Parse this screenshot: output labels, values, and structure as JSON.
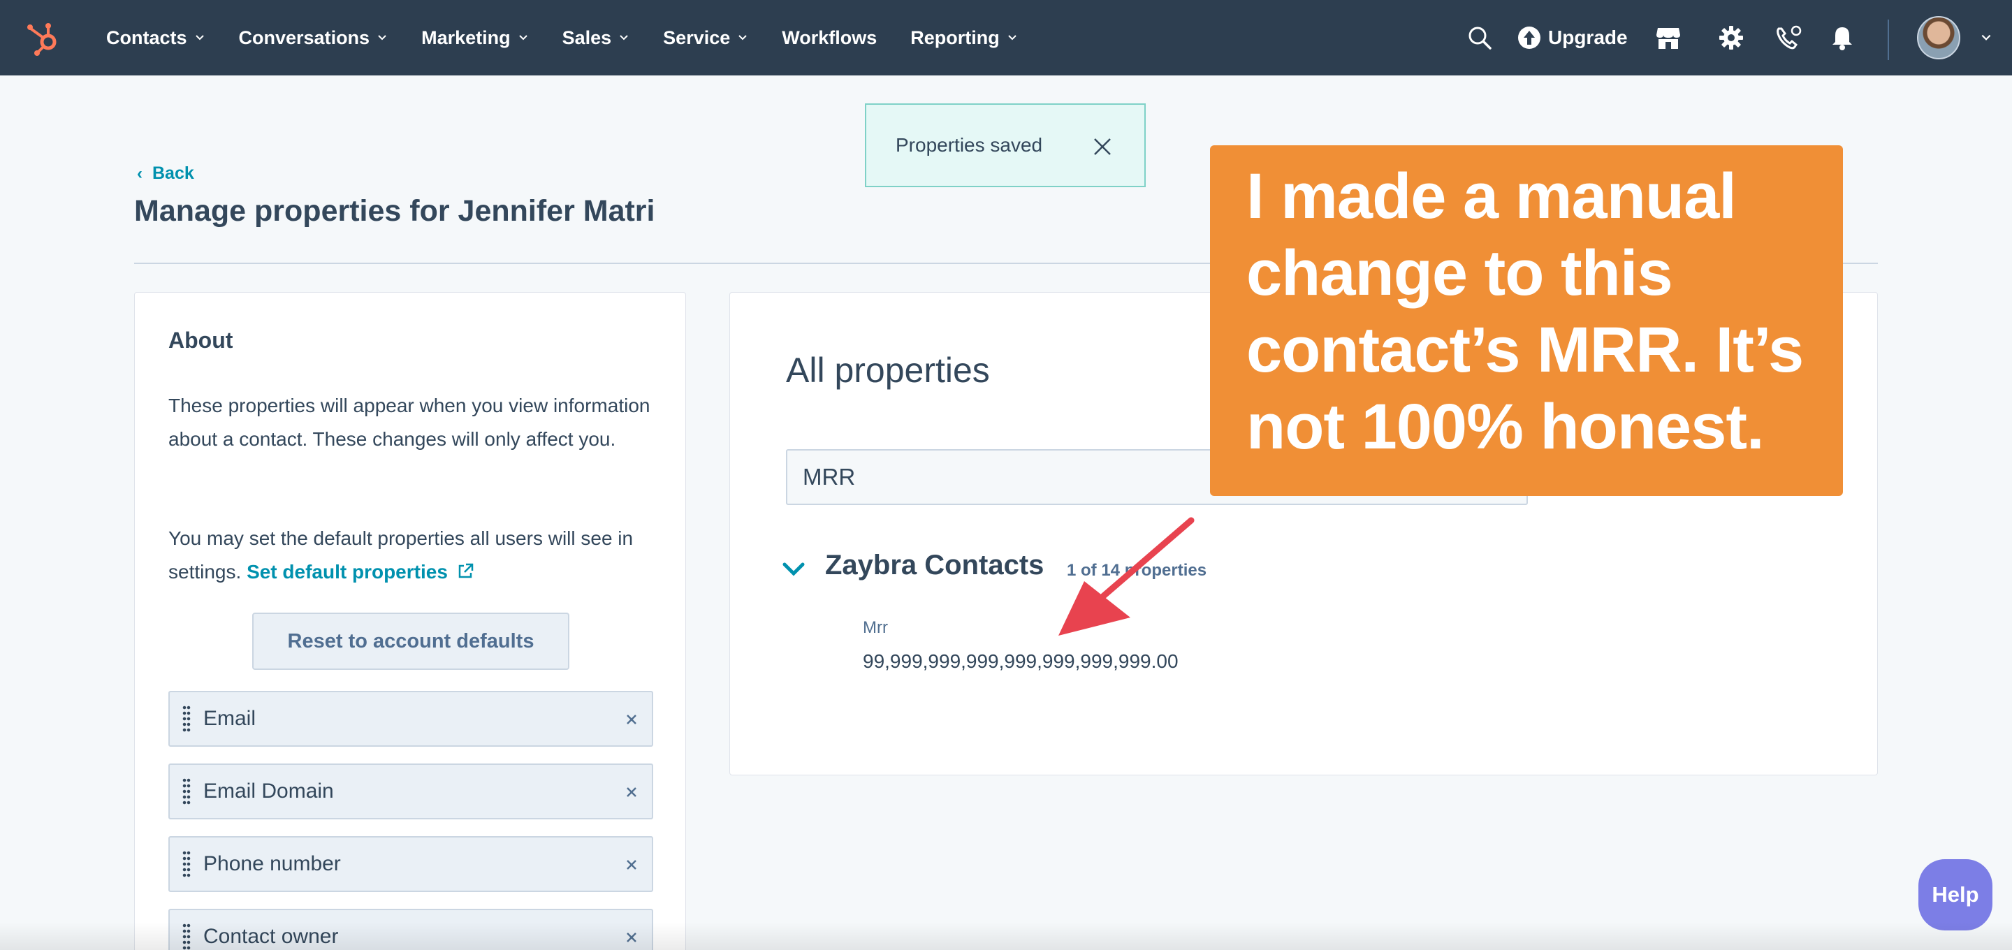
{
  "nav": {
    "items": [
      {
        "label": "Contacts",
        "has_menu": true
      },
      {
        "label": "Conversations",
        "has_menu": true
      },
      {
        "label": "Marketing",
        "has_menu": true
      },
      {
        "label": "Sales",
        "has_menu": true
      },
      {
        "label": "Service",
        "has_menu": true
      },
      {
        "label": "Workflows",
        "has_menu": false
      },
      {
        "label": "Reporting",
        "has_menu": true
      }
    ],
    "upgrade_label": "Upgrade",
    "icons": [
      "search-icon",
      "upgrade-icon",
      "marketplace-icon",
      "gear-icon",
      "calling-icon",
      "bell-icon",
      "avatar",
      "chevron-down-icon"
    ],
    "bar_color": "#2d3e50",
    "logo_color": "#ff7a59"
  },
  "toast": {
    "text": "Properties saved"
  },
  "header": {
    "back_label": "Back",
    "title": "Manage properties for Jennifer Matri"
  },
  "about": {
    "title": "About",
    "p1": "These properties will appear when you view information about a contact. These changes will only affect you.",
    "p2_prefix": "You may set the default properties all users will see in settings.",
    "p2_link": "Set default properties",
    "reset_label": "Reset to account defaults",
    "properties": [
      {
        "label": "Email"
      },
      {
        "label": "Email Domain"
      },
      {
        "label": "Phone number"
      },
      {
        "label": "Contact owner"
      }
    ]
  },
  "all_properties": {
    "title": "All properties",
    "search_value": "MRR",
    "group_title": "Zaybra Contacts",
    "group_count": "1 of 14 properties",
    "property_label": "Mrr",
    "property_value": "99,999,999,999,999,999,999,999.00"
  },
  "annotation": {
    "text": "I made a manual change to this contact’s MRR. It’s not 100% honest.",
    "color": "#f08f36",
    "arrow_color": "#e8434f"
  },
  "help": {
    "label": "Help"
  },
  "colors": {
    "accent": "#0091ae",
    "background": "#f5f8fa",
    "text": "#33475b",
    "toast_bg": "#e5f8f6",
    "help": "#7c7ee6"
  }
}
